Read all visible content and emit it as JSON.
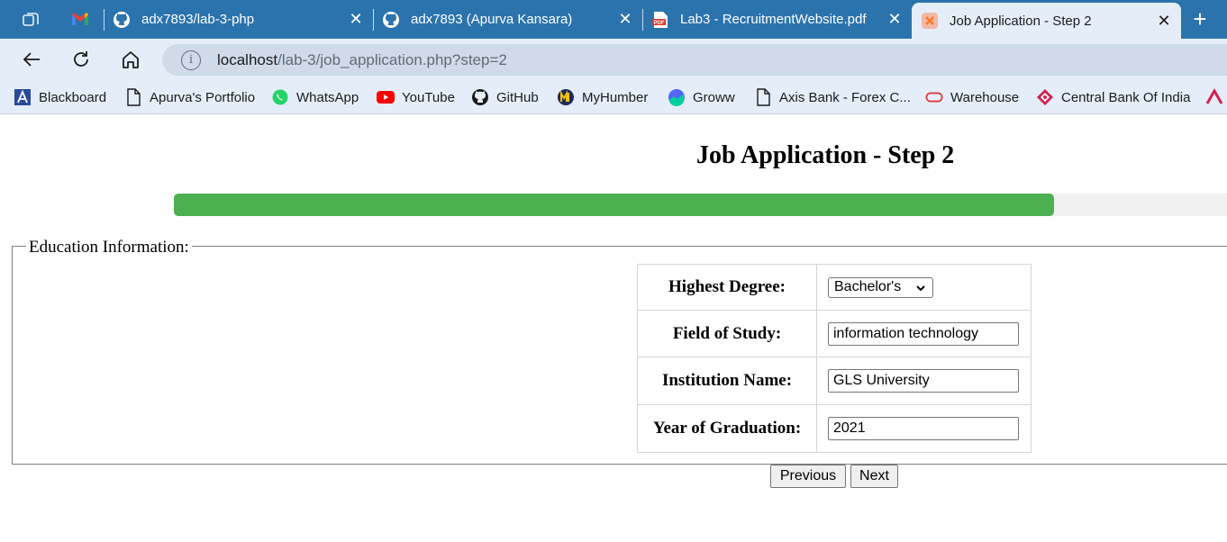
{
  "browser": {
    "tabs": [
      {
        "title": "adx7893/lab-3-php",
        "icon": "github-icon"
      },
      {
        "title": "adx7893 (Apurva Kansara)",
        "icon": "github-icon"
      },
      {
        "title": "Lab3 - RecruitmentWebsite.pdf",
        "icon": "pdf-icon"
      },
      {
        "title": "Job Application - Step 2",
        "icon": "xampp-icon",
        "active": true
      }
    ],
    "pinned_icons": [
      "tab-actions-icon",
      "gmail-icon"
    ],
    "new_tab_icon": "plus-icon",
    "address": {
      "host": "localhost",
      "path": "/lab-3/job_application.php?step=2",
      "info_icon": "i"
    },
    "nav_icons": [
      "back-icon",
      "refresh-icon",
      "home-icon"
    ],
    "bookmarks": [
      {
        "label": "Blackboard",
        "icon": "blackboard-icon"
      },
      {
        "label": "Apurva's Portfolio",
        "icon": "page-icon"
      },
      {
        "label": "WhatsApp",
        "icon": "whatsapp-icon"
      },
      {
        "label": "YouTube",
        "icon": "youtube-icon"
      },
      {
        "label": "GitHub",
        "icon": "github-icon"
      },
      {
        "label": "MyHumber",
        "icon": "myhumber-icon"
      },
      {
        "label": "Groww",
        "icon": "groww-icon"
      },
      {
        "label": "Axis Bank - Forex C...",
        "icon": "page-icon"
      },
      {
        "label": "Warehouse",
        "icon": "warehouse-icon"
      },
      {
        "label": "Central Bank Of India",
        "icon": "centralbank-icon"
      }
    ]
  },
  "page": {
    "heading": "Job Application - Step 2",
    "progress": 0.836,
    "section_legend": "Education Information:",
    "fields": {
      "degree": {
        "label": "Highest Degree:",
        "value": "Bachelor's"
      },
      "field": {
        "label": "Field of Study:",
        "value": "information technology"
      },
      "institution": {
        "label": "Institution Name:",
        "value": "GLS University"
      },
      "year": {
        "label": "Year of Graduation:",
        "value": "2021"
      }
    },
    "buttons": {
      "previous": "Previous",
      "next": "Next"
    }
  },
  "colors": {
    "tabstrip": "#2b73ad",
    "toolbar": "#e5eef8",
    "progress_fill": "#4caf50",
    "progress_track": "#f1f1f1"
  }
}
